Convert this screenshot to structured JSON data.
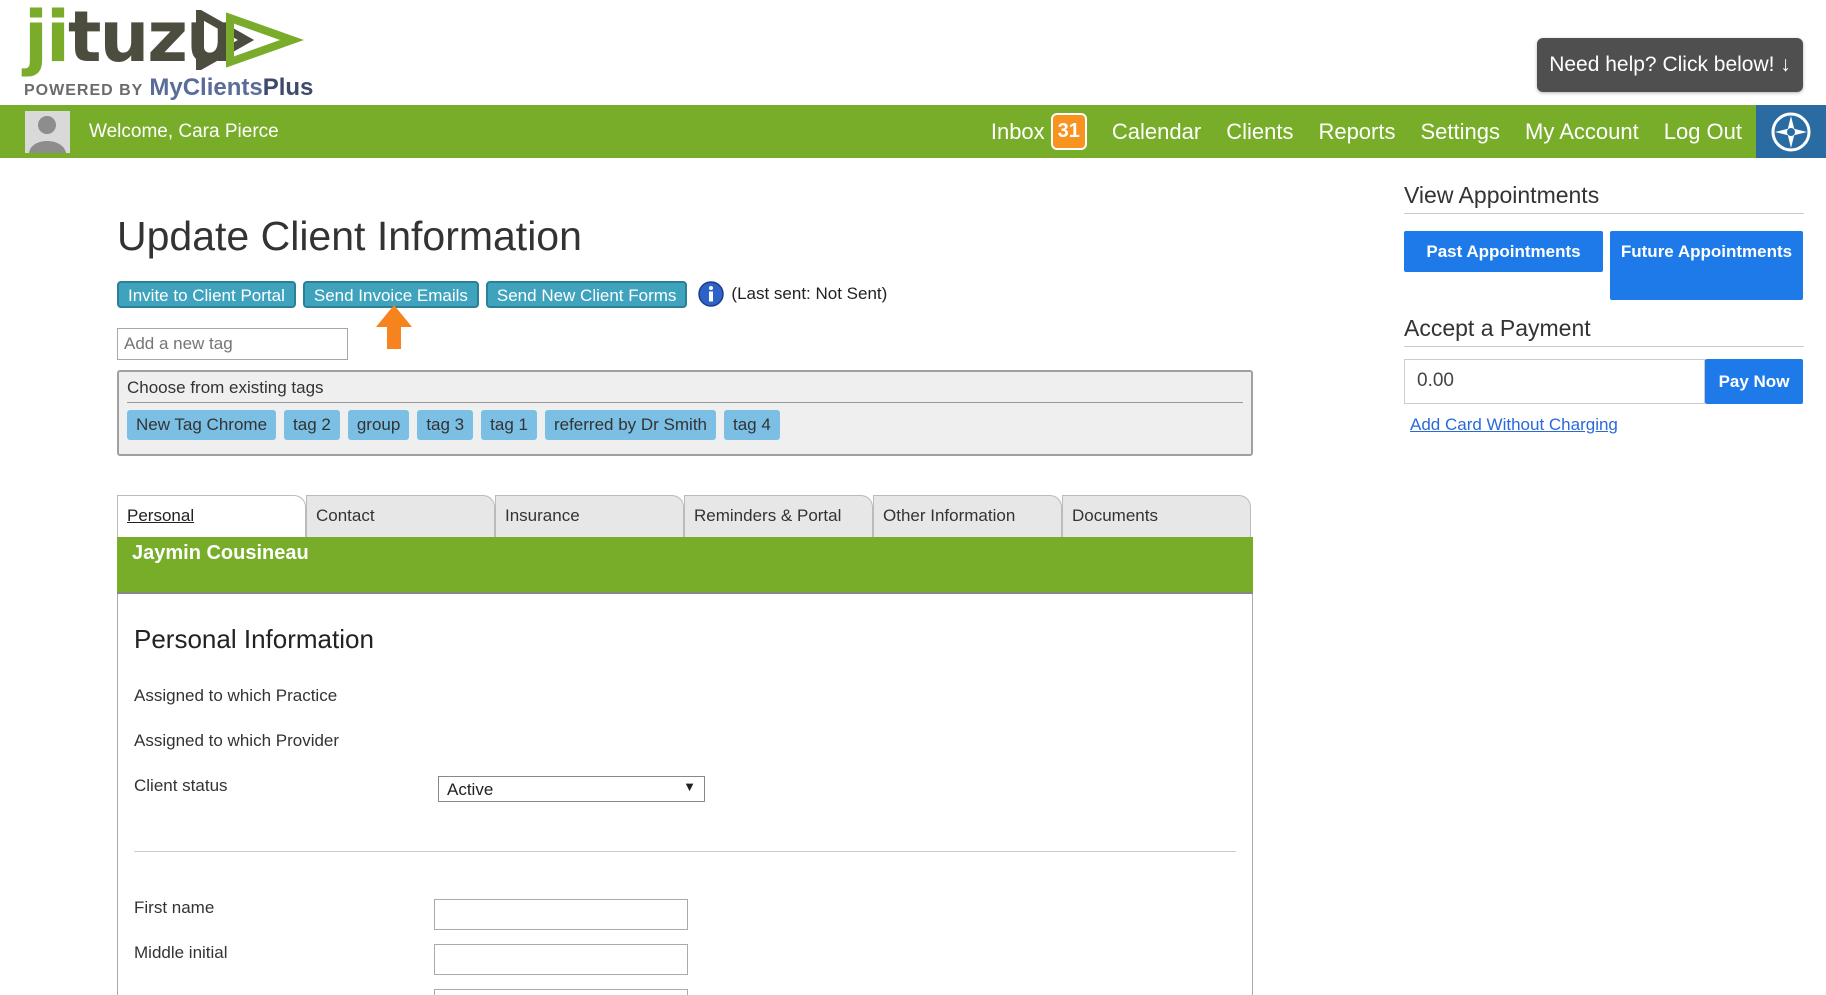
{
  "brand": {
    "logo_text_a": "ji",
    "logo_text_b": "tuzu",
    "powered_by": "POWERED BY",
    "sub_brand_a": "My",
    "sub_brand_b": "Clients",
    "sub_brand_c": "Plus",
    "primary_green": "#78ad2a",
    "accent_blue": "#1d7ae8"
  },
  "help_button": "Need help? Click below! ↓",
  "topbar": {
    "welcome": "Welcome, Cara Pierce",
    "nav": {
      "inbox": "Inbox",
      "inbox_count": "31",
      "calendar": "Calendar",
      "clients": "Clients",
      "reports": "Reports",
      "settings": "Settings",
      "my_account": "My Account",
      "log_out": "Log Out"
    }
  },
  "page": {
    "title": "Update Client Information",
    "actions": {
      "invite": "Invite to Client Portal",
      "send_invoice": "Send Invoice Emails",
      "send_forms": "Send New Client Forms",
      "last_sent": "(Last sent: Not Sent)"
    },
    "tag_input_placeholder": "Add a new tag",
    "existing_tags_label": "Choose from existing tags",
    "tags": [
      "New Tag Chrome",
      "tag 2",
      "group",
      "tag 3",
      "tag 1",
      "referred by Dr Smith",
      "tag 4"
    ]
  },
  "tabs": [
    "Personal",
    "Contact",
    "Insurance",
    "Reminders & Portal",
    "Other Information",
    "Documents"
  ],
  "client_name": "Jaymin Cousineau",
  "personal": {
    "section_title": "Personal Information",
    "practice_label": "Assigned to which Practice",
    "provider_label": "Assigned to which Provider",
    "status_label": "Client status",
    "status_value": "Active",
    "first_name_label": "First name",
    "middle_initial_label": "Middle initial"
  },
  "sidebar": {
    "view_appointments": "View Appointments",
    "past_appointments": "Past Appointments",
    "future_appointments": "Future Appointments",
    "accept_payment": "Accept a Payment",
    "payment_amount": "0.00",
    "pay_now": "Pay Now",
    "add_card": "Add Card Without Charging"
  }
}
